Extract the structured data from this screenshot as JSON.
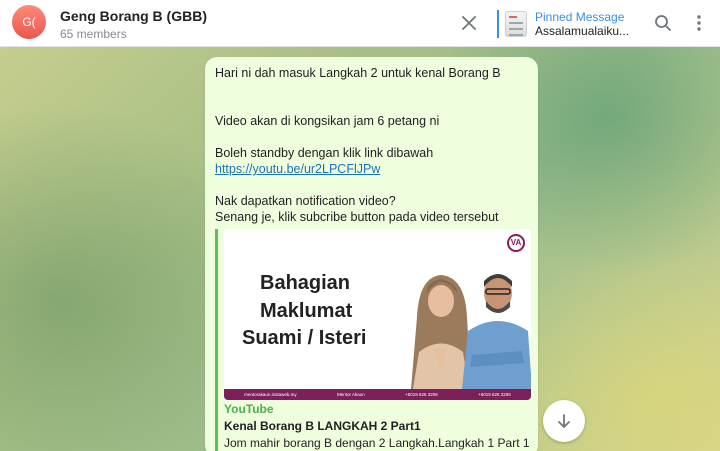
{
  "header": {
    "avatar_initials": "G(",
    "title": "Geng Borang B (GBB)",
    "members": "65 members",
    "pinned_title": "Pinned Message",
    "pinned_text": "Assalamualaiku..."
  },
  "message": {
    "lines": [
      "Hari ni dah masuk Langkah 2 untuk kenal Borang B",
      "",
      "Video akan di kongsikan jam 6 petang ni",
      "Boleh standby dengan klik link dibawah"
    ],
    "link": "https://youtu.be/ur2LPCFlJPw",
    "line_notify": "Nak dapatkan notification video?",
    "line_subscribe": "Senang je, klik subcribe button pada video tersebut"
  },
  "preview": {
    "thumb_line1": "Bahagian",
    "thumb_line2": "Maklumat",
    "thumb_line3": "Suami / Isteri",
    "footer_items": [
      "mentorakaun.instaweb.my",
      "Mentor Akaun",
      "+6019 626 3206",
      "+6019 626 3206"
    ],
    "source": "YouTube",
    "title": "Kenal Borang B LANGKAH 2 Part1",
    "description": "Jom mahir borang B dengan 2 Langkah.Langkah 1 Part 1 -"
  },
  "colors": {
    "accent": "#3390ec",
    "bubble": "#effedd",
    "preview_bar": "#5fbf58",
    "brand": "#7c1f5a"
  }
}
